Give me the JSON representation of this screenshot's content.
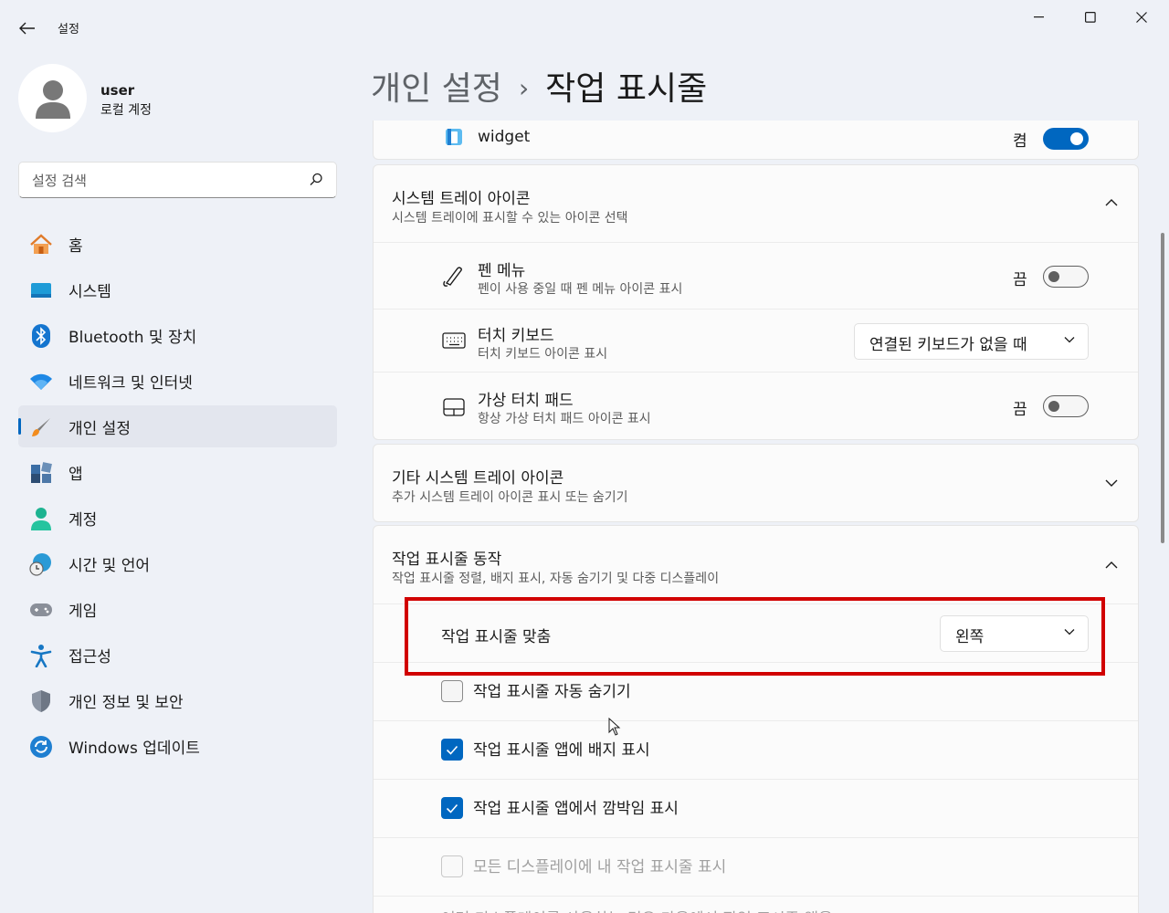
{
  "window": {
    "title": "설정"
  },
  "user": {
    "name": "user",
    "account_type": "로컬 계정"
  },
  "search": {
    "placeholder": "설정 검색"
  },
  "sidebar": {
    "items": [
      {
        "label": "홈",
        "icon": "home-icon"
      },
      {
        "label": "시스템",
        "icon": "system-icon"
      },
      {
        "label": "Bluetooth 및 장치",
        "icon": "bluetooth-icon"
      },
      {
        "label": "네트워크 및 인터넷",
        "icon": "wifi-icon"
      },
      {
        "label": "개인 설정",
        "icon": "brush-icon",
        "active": true
      },
      {
        "label": "앱",
        "icon": "apps-icon"
      },
      {
        "label": "계정",
        "icon": "account-icon"
      },
      {
        "label": "시간 및 언어",
        "icon": "globe-clock-icon"
      },
      {
        "label": "게임",
        "icon": "gamepad-icon"
      },
      {
        "label": "접근성",
        "icon": "accessibility-icon"
      },
      {
        "label": "개인 정보 및 보안",
        "icon": "shield-icon"
      },
      {
        "label": "Windows 업데이트",
        "icon": "update-icon"
      }
    ]
  },
  "breadcrumb": {
    "parent": "개인 설정",
    "separator": "›",
    "current": "작업 표시줄"
  },
  "widget_row": {
    "label": "widget",
    "state": "켬"
  },
  "tray_icons": {
    "title": "시스템 트레이 아이콘",
    "subtitle": "시스템 트레이에 표시할 수 있는 아이콘 선택",
    "items": [
      {
        "title": "펜 메뉴",
        "subtitle": "펜이 사용 중일 때 펜 메뉴 아이콘 표시",
        "state": "끔"
      },
      {
        "title": "터치 키보드",
        "subtitle": "터치 키보드 아이콘 표시",
        "dropdown": "연결된 키보드가 없을 때"
      },
      {
        "title": "가상 터치 패드",
        "subtitle": "항상 가상 터치 패드 아이콘 표시",
        "state": "끔"
      }
    ]
  },
  "other_tray": {
    "title": "기타 시스템 트레이 아이콘",
    "subtitle": "추가 시스템 트레이 아이콘 표시 또는 숨기기"
  },
  "behaviors": {
    "title": "작업 표시줄 동작",
    "subtitle": "작업 표시줄 정렬, 배지 표시, 자동 숨기기 및 다중 디스플레이",
    "alignment": {
      "label": "작업 표시줄 맞춤",
      "value": "왼쪽"
    },
    "checks": [
      {
        "label": "작업 표시줄 자동 숨기기",
        "checked": false
      },
      {
        "label": "작업 표시줄 앱에 배지 표시",
        "checked": true
      },
      {
        "label": "작업 표시줄 앱에서 깜박임 표시",
        "checked": true
      },
      {
        "label": "모든 디스플레이에 내 작업 표시줄 표시",
        "checked": false,
        "disabled": true
      }
    ],
    "cut_text": "여러 디스플레이를 사용하는 경우 다음에서 작업 표시줄 앱을"
  },
  "colors": {
    "accent": "#0067c0",
    "highlight": "#d10000"
  }
}
